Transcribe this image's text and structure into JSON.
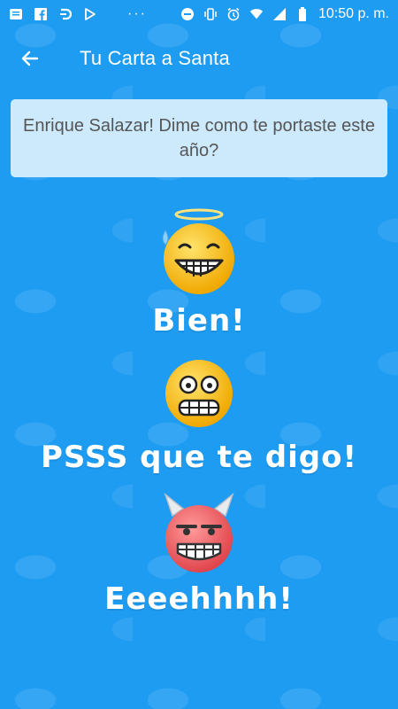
{
  "status_bar": {
    "time": "10:50 p. m.",
    "left_icons": [
      "message-icon",
      "facebook-icon",
      "d-app-icon",
      "play-store-icon"
    ],
    "right_icons": [
      "do-not-disturb-icon",
      "vibrate-icon",
      "alarm-icon",
      "wifi-icon",
      "signal-icon",
      "battery-icon"
    ],
    "overflow": "···"
  },
  "app_bar": {
    "title": "Tu Carta a Santa",
    "back_icon": "arrow-left-icon"
  },
  "prompt": {
    "text": "Enrique Salazar! Dime como te portaste este año?"
  },
  "options": [
    {
      "label": "Bien!",
      "icon": "angel-grin-emoji",
      "color": "#f7c21a"
    },
    {
      "label": "PSSS que te digo!",
      "icon": "grimace-emoji",
      "color": "#f7c21a"
    },
    {
      "label": "Eeeehhhh!",
      "icon": "devil-grin-emoji",
      "color": "#f06a6a"
    }
  ],
  "colors": {
    "background": "#1e9cf2",
    "card": "#cdeafc",
    "card_text": "#555555"
  }
}
